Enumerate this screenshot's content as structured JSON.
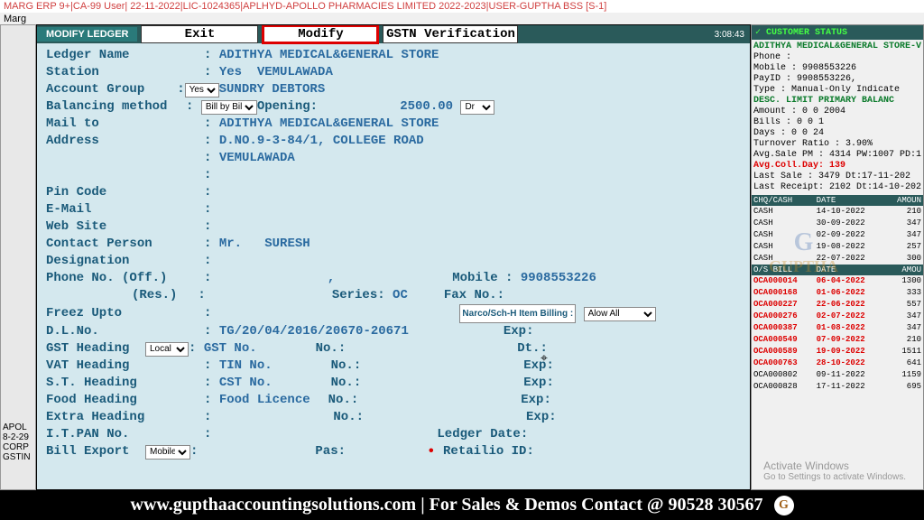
{
  "titlebar": "MARG ERP 9+|CA-99 User| 22-11-2022|LIC-1024365|APLHYD-APOLLO PHARMACIES LIMITED 2022-2023|USER-GUPTHA BSS [S-1]",
  "menubar": "Marg",
  "left_gutter": {
    "l1": "APOL",
    "l2": "8-2-29",
    "l3": "CORP",
    "l4": "GSTIN"
  },
  "tabs": {
    "modify_ledger": "MODIFY LEDGER",
    "exit": "Exit",
    "modify": "Modify",
    "gstn": "GSTN Verification",
    "timer": "3:08:43"
  },
  "form": {
    "ledger_name_lbl": "Ledger Name",
    "ledger_name_val": "ADITHYA MEDICAL&GENERAL STORE",
    "station_lbl": "Station",
    "station_yes": "Yes",
    "station_val": "VEMULAWADA",
    "account_group_lbl": "Account Group",
    "account_group_sel": "Yes",
    "account_group_val": "SUNDRY DEBTORS",
    "bal_method_lbl": "Balancing method",
    "bal_method_sel": "Bill by Bill",
    "opening_lbl": "Opening:",
    "opening_val": "2500.00",
    "opening_drcr": "Dr",
    "mail_to_lbl": "Mail to",
    "mail_to_val": "ADITHYA MEDICAL&GENERAL STORE",
    "address_lbl": "Address",
    "address_l1": "D.NO.9-3-84/1, COLLEGE ROAD",
    "address_l2": "VEMULAWADA",
    "pin_lbl": "Pin Code",
    "email_lbl": "E-Mail",
    "web_lbl": "Web Site",
    "contact_lbl": "Contact Person",
    "contact_pref": "Mr.",
    "contact_val": "SURESH",
    "designation_lbl": "Designation",
    "phone_off_lbl": "Phone No. (Off.)",
    "phone_off_val": ",",
    "mobile_lbl": "Mobile :",
    "mobile_val": "9908553226",
    "phone_res_lbl": "(Res.)",
    "series_lbl": "Series:",
    "series_val": "OC",
    "fax_lbl": "Fax No.:",
    "freez_lbl": "Freez Upto",
    "narco_lbl": "Narco/Sch-H Item Billing :",
    "narco_sel": "Alow All",
    "dlno_lbl": "D.L.No.",
    "dlno_val": "TG/20/04/2016/20670-20671",
    "exp_lbl": "Exp:",
    "gst_heading_lbl": "GST  Heading",
    "gst_heading_sel": "Local",
    "gst_no_lbl": "GST  No.",
    "no_lbl": "No.:",
    "dt_lbl": "Dt.:",
    "vat_heading_lbl": "VAT  Heading",
    "tin_no_lbl": "TIN  No.",
    "st_heading_lbl": "S.T. Heading",
    "cst_no_lbl": "CST  No.",
    "food_heading_lbl": "Food Heading",
    "food_lic_lbl": "Food Licence",
    "extra_heading_lbl": "Extra Heading",
    "itpan_lbl": "I.T.PAN No.",
    "ledger_date_lbl": "Ledger Date:",
    "bill_export_lbl": "Bill Export",
    "bill_export_sel": "Mobile",
    "pas_lbl": "Pas:",
    "retailio_lbl": "Retailio ID:"
  },
  "customer": {
    "header": "✓ CUSTOMER STATUS",
    "name": "ADITHYA MEDICAL&GENERAL STORE-V",
    "phone": "Phone  :",
    "mobile": "Mobile : 9908553226",
    "payid": "PayID  : 9908553226,",
    "type": "Type   : Manual-Only Indicate",
    "desc_hdr": "DESC.    LIMIT PRIMARY BALANC",
    "amount": "Amount :      0      0   2004",
    "bills": "Bills  :      0      0      1",
    "days": "Days   :      0      0     24",
    "turnover": "Turnover Ratio : 3.90%",
    "avgsale": "Avg.Sale PM : 4314 PW:1007 PD:1",
    "avgcoll": "Avg.Coll.Day: 139",
    "lastsale": "Last Sale   : 3479 Dt:17-11-202",
    "lastrcpt": "Last Receipt: 2102 Dt:14-10-202",
    "cash_hdr": {
      "c1": "CHQ/CASH",
      "c2": "DATE",
      "c3": "AMOUN"
    },
    "cash": [
      {
        "c1": "CASH",
        "c2": "14-10-2022",
        "c3": "210"
      },
      {
        "c1": "CASH",
        "c2": "30-09-2022",
        "c3": "347"
      },
      {
        "c1": "CASH",
        "c2": "02-09-2022",
        "c3": "347"
      },
      {
        "c1": "CASH",
        "c2": "19-08-2022",
        "c3": "257"
      },
      {
        "c1": "CASH",
        "c2": "22-07-2022",
        "c3": "300"
      }
    ],
    "osbill_hdr": {
      "c1": "O/S BILL",
      "c2": "DATE",
      "c3": "AMOU"
    },
    "osbill": [
      {
        "c1": "OCA000014",
        "c2": "06-04-2022",
        "c3": "1300",
        "red": true
      },
      {
        "c1": "OCA000168",
        "c2": "01-06-2022",
        "c3": "333",
        "red": true
      },
      {
        "c1": "OCA000227",
        "c2": "22-06-2022",
        "c3": "557",
        "red": true
      },
      {
        "c1": "OCA000276",
        "c2": "02-07-2022",
        "c3": "347",
        "red": true
      },
      {
        "c1": "OCA000387",
        "c2": "01-08-2022",
        "c3": "347",
        "red": true
      },
      {
        "c1": "OCA000549",
        "c2": "07-09-2022",
        "c3": "210",
        "red": true
      },
      {
        "c1": "OCA000589",
        "c2": "19-09-2022",
        "c3": "1511",
        "red": true
      },
      {
        "c1": "OCA000763",
        "c2": "28-10-2022",
        "c3": "641",
        "red": true
      },
      {
        "c1": "OCA000802",
        "c2": "09-11-2022",
        "c3": "1159",
        "red": false
      },
      {
        "c1": "OCA000828",
        "c2": "17-11-2022",
        "c3": "695",
        "red": false
      }
    ]
  },
  "activate": {
    "l1": "Activate Windows",
    "l2": "Go to Settings to activate Windows."
  },
  "footer": "www.gupthaaccountingsolutions.com | For Sales & Demos Contact @ 90528 30567",
  "watermark": {
    "g": "G",
    "t": "GUPTHA"
  }
}
